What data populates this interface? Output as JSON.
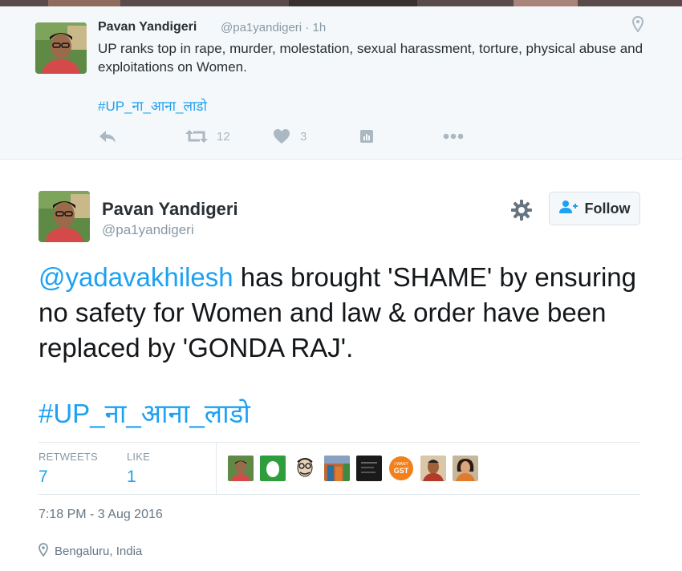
{
  "context_tweet": {
    "author_name": "Pavan Yandigeri",
    "author_handle": "@pa1yandigeri",
    "separator": "·",
    "time_ago": "1h",
    "text": "UP ranks top in rape, murder, molestation, sexual harassment, torture, physical abuse and exploitations on Women.",
    "hashtag": "#UP_ना_आना_लाडो",
    "retweet_count": "12",
    "like_count": "3"
  },
  "main_tweet": {
    "author_name": "Pavan Yandigeri",
    "author_handle": "@pa1yandigeri",
    "follow_label": "Follow",
    "mention": "@yadavakhilesh",
    "text": " has brought 'SHAME' by ensuring no safety for Women and law & order have been replaced by 'GONDA RAJ'.",
    "hashtag": "#UP_ना_आना_लाडो",
    "stats": {
      "retweets_label": "RETWEETS",
      "retweets_value": "7",
      "likes_label": "LIKE",
      "likes_value": "1"
    },
    "likers": [
      "avatar-person",
      "avatar-green-egg",
      "avatar-cartoon",
      "avatar-flag-crowd",
      "avatar-dark",
      "avatar-gst",
      "avatar-man",
      "avatar-woman"
    ],
    "gst_badge_top": "I WANT",
    "gst_badge_main": "GST",
    "timestamp": "7:18 PM - 3 Aug 2016",
    "location": "Bengaluru, India"
  },
  "colors": {
    "link": "#1da1f2",
    "muted": "#8899a6",
    "icon": "#aab8c2",
    "context_bg": "#f5f8fa"
  }
}
